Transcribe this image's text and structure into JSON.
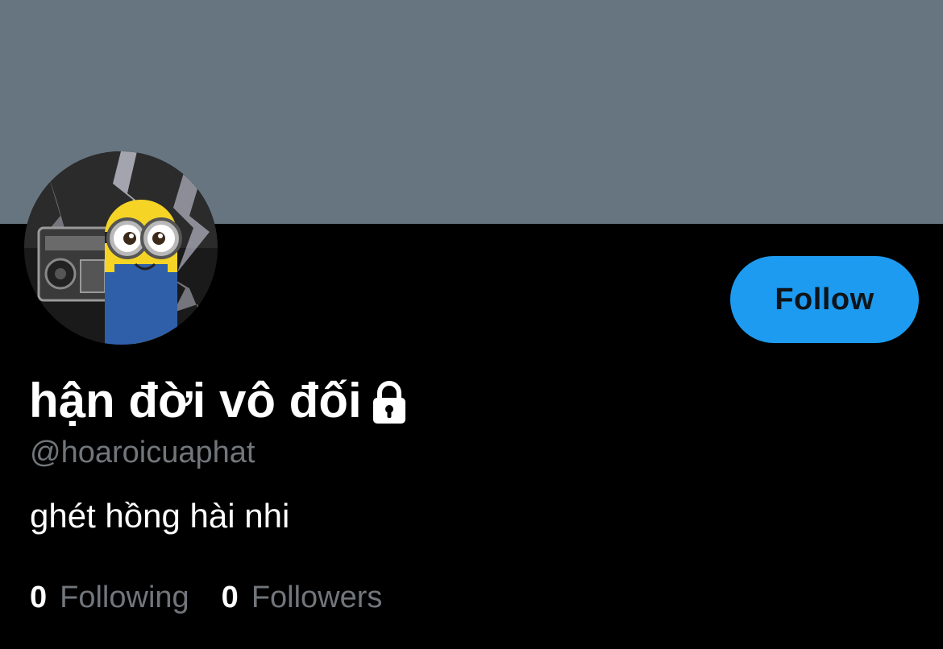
{
  "profile": {
    "display_name": "hận đời vô đối",
    "handle": "@hoaroicuaphat",
    "bio": "ghét hồng hài nhi",
    "protected_icon": "lock-icon",
    "avatar_icon": "profile-avatar"
  },
  "actions": {
    "follow_label": "Follow"
  },
  "stats": {
    "following_count": "0",
    "following_label": "Following",
    "followers_count": "0",
    "followers_label": "Followers"
  },
  "colors": {
    "banner": "#66757f",
    "background": "#000000",
    "accent": "#1d9bf0",
    "secondary_text": "#71767b",
    "primary_text": "#ffffff"
  }
}
